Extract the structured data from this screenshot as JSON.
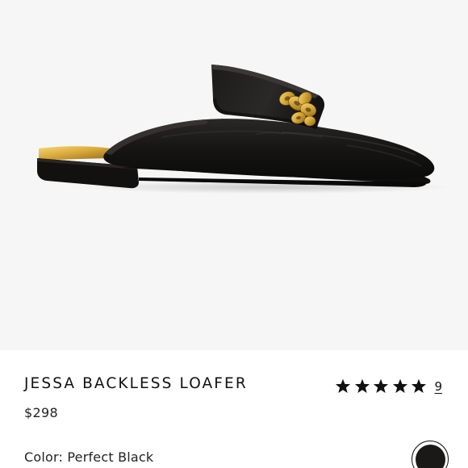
{
  "product": {
    "name": "JESSA BACKLESS LOAFER",
    "price": "$298",
    "color_prefix": "Color: ",
    "color_name": "Perfect Black",
    "rating": 5,
    "max_rating": 5,
    "review_count": "9"
  },
  "colors": {
    "hero_background": "#f6f6f6",
    "swatch_fill": "#1b1918",
    "star": "#111111"
  },
  "icons": {
    "star": "star-icon",
    "swatch": "color-swatch"
  }
}
